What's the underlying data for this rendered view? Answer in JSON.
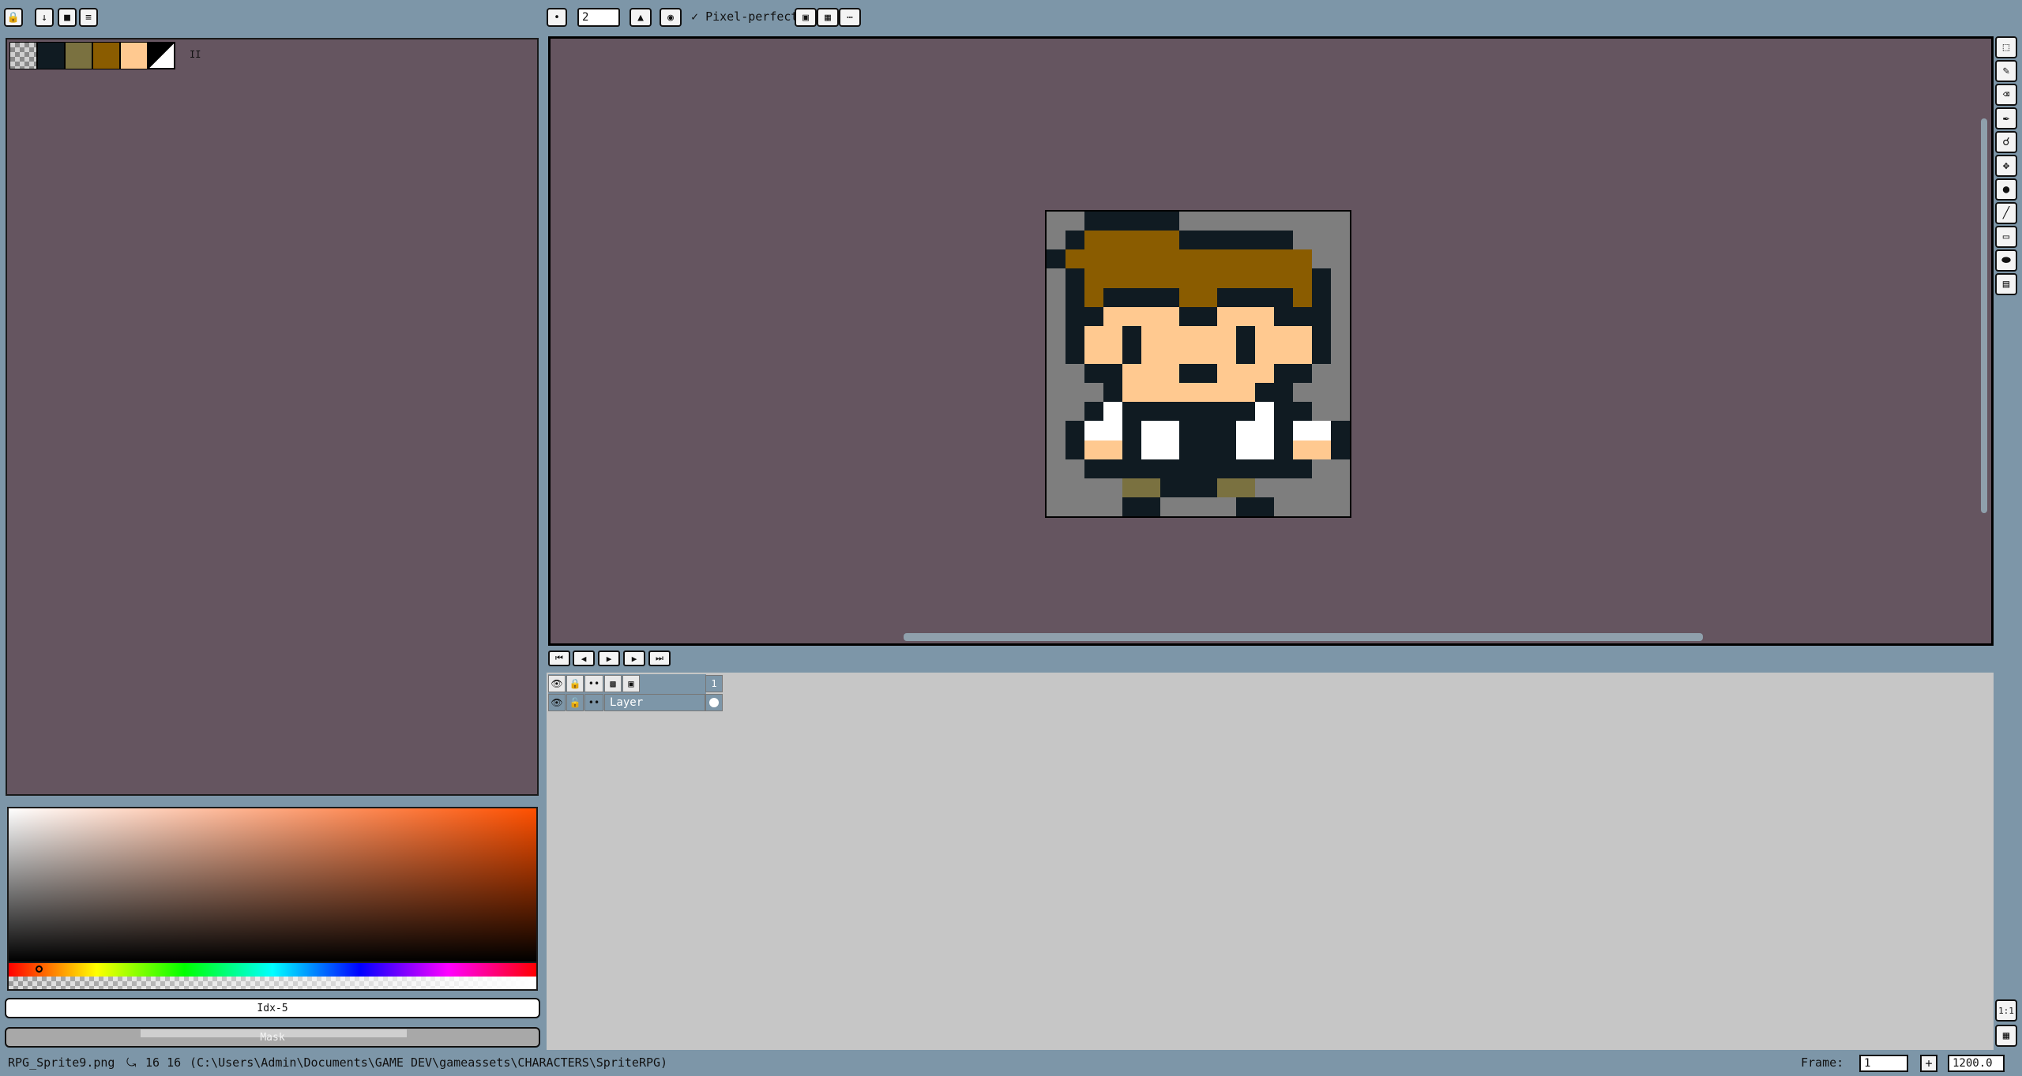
{
  "top_left_toolbar": {
    "buttons": [
      "lock-icon",
      "arrow-down-icon",
      "square-icon",
      "menu-icon"
    ]
  },
  "context_bar": {
    "brush_size": "2",
    "pixel_perfect_label": "Pixel-perfect",
    "pixel_perfect_checked": true
  },
  "palette": {
    "colors": [
      "#101b22",
      "#7a7140",
      "#8a5c00",
      "#ffc990"
    ],
    "resize_handle": "II"
  },
  "color_picker": {
    "hue_color": "#ff5000",
    "index_label": "Idx-5",
    "mask_label": "Mask"
  },
  "sprite": {
    "width": 16,
    "height": 16,
    "rows": [
      "..DDDDD.........",
      ".DBBBBBDDDDDD...",
      "DBBBBBBBBBBBBB..",
      ".DBBBBBBBBBBBBD.",
      ".DBDDDDBBDDDDBD.",
      ".DDSSSSDDSSSDDD.",
      ".DSSDSSSSSDSSSD.",
      ".DSSDSSSSSDSSSD.",
      "..DDSSSDDSSSDD..",
      "...DSSSSSSSDD...",
      "..DWDDDDDDDWDD..",
      ".DWWDWWDDDWWDWWD",
      ".DSSDWWDDDWWDSSD",
      "..DDDDDDDDDDDD..",
      "....OODDDOO.....",
      "....DD....DD...."
    ],
    "legend": {
      "D": "#101b22",
      "B": "#8a5c00",
      "S": "#ffc990",
      "W": "#ffffff",
      "O": "#7a7140",
      ".": "#7e7e7e"
    }
  },
  "timeline": {
    "frame_header": "1",
    "layer_name": "Layer"
  },
  "status": {
    "filename": "RPG_Sprite9.png",
    "dimensions": "16 16",
    "path": "(C:\\Users\\Admin\\Documents\\GAME DEV\\gameassets\\CHARACTERS\\SpriteRPG)",
    "frame_label": "Frame:",
    "frame_value": "1",
    "zoom_value": "1200.0"
  }
}
